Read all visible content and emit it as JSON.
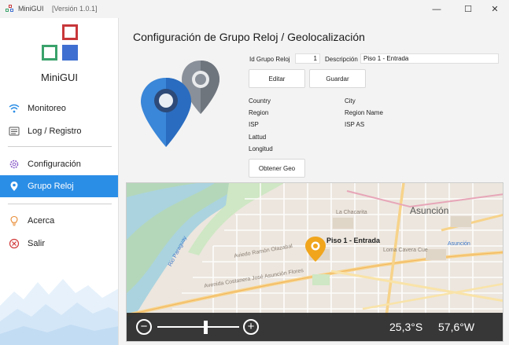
{
  "window": {
    "title": "MiniGUI",
    "version": "[Versión 1.0.1]",
    "minimize_glyph": "—",
    "maximize_glyph": "☐",
    "close_glyph": "✕"
  },
  "sidebar": {
    "brand": "MiniGUI",
    "items": [
      {
        "label": "Monitoreo",
        "icon": "wifi-icon"
      },
      {
        "label": "Log / Registro",
        "icon": "log-icon"
      },
      {
        "label": "Configuración",
        "icon": "gear-icon"
      },
      {
        "label": "Grupo Reloj",
        "icon": "location-icon"
      },
      {
        "label": "Acerca",
        "icon": "bulb-icon"
      },
      {
        "label": "Salir",
        "icon": "exit-icon"
      }
    ],
    "active_index": 3
  },
  "main": {
    "title": "Configuración de Grupo Reloj / Geolocalización",
    "id_label": "Id Grupo Reloj",
    "id_value": "1",
    "desc_label": "Descripción",
    "desc_value": "Piso 1 - Entrada",
    "edit_button": "Editar",
    "save_button": "Guardar",
    "info_left": [
      "Country",
      "Region",
      "ISP",
      "Lattud",
      "Longitud"
    ],
    "info_right": [
      "City",
      "Region Name",
      "ISP AS"
    ],
    "geo_button": "Obtener Geo"
  },
  "map": {
    "marker_label": "Piso 1 - Entrada",
    "lat": "25,3°S",
    "lon": "57,6°W",
    "zoom_out": "−",
    "zoom_in": "+",
    "zoom_level": 0.6,
    "labels": {
      "city": "Asunción",
      "city_blue": "Asunción",
      "la_chacarita": "La Chacarita",
      "loma_cue": "Loma Cavera Cue",
      "avenida": "Avenida Costanera José Asunción Flores",
      "artigas": "Aviedo Ramón Olazabal",
      "rio": "Rio Paraguay"
    }
  },
  "colors": {
    "accent": "#2b8ee6",
    "pin_blue": "#3a86d8",
    "pin_gray": "#8a9099",
    "logo_red": "#c8373a",
    "logo_green": "#3aa26b",
    "logo_blue": "#3f6fd1"
  }
}
